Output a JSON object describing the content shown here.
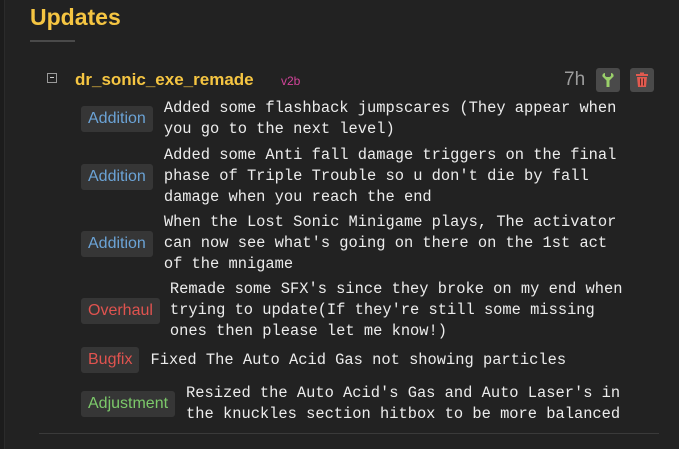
{
  "section": {
    "title": "Updates"
  },
  "entry": {
    "mod_name": "dr_sonic_exe_remade",
    "version": "v2b",
    "time_ago": "7h",
    "changes": [
      {
        "type": "Addition",
        "text": "Added some flashback jumpscares (They appear when\nyou go to the next level)"
      },
      {
        "type": "Addition",
        "text": "Added some Anti fall damage triggers on the final\nphase of Triple Trouble so u don't die by fall\ndamage when you reach the end"
      },
      {
        "type": "Addition",
        "text": "When the Lost Sonic Minigame plays, The activator\ncan now see what's going on there on the 1st act\nof the mnigame"
      },
      {
        "type": "Overhaul",
        "text": "Remade some SFX's since they broke on my end when\ntrying to update(If they're still some missing\nones then please let me know!)"
      },
      {
        "type": "Bugfix",
        "text": "Fixed The Auto Acid Gas not showing particles"
      },
      {
        "type": "Adjustment",
        "text": "Resized the Auto Acid's Gas and Auto Laser's in\nthe knuckles section hitbox to be more balanced"
      }
    ]
  },
  "colors": {
    "title": "#f5c542",
    "version": "#d2449a",
    "addition": "#6ba3d6",
    "overhaul": "#e0534f",
    "bugfix": "#e0534f",
    "adjustment": "#7cc96a"
  },
  "icons": {
    "collapse": "minus-square-icon",
    "edit": "wrench-icon",
    "delete": "trash-icon"
  }
}
